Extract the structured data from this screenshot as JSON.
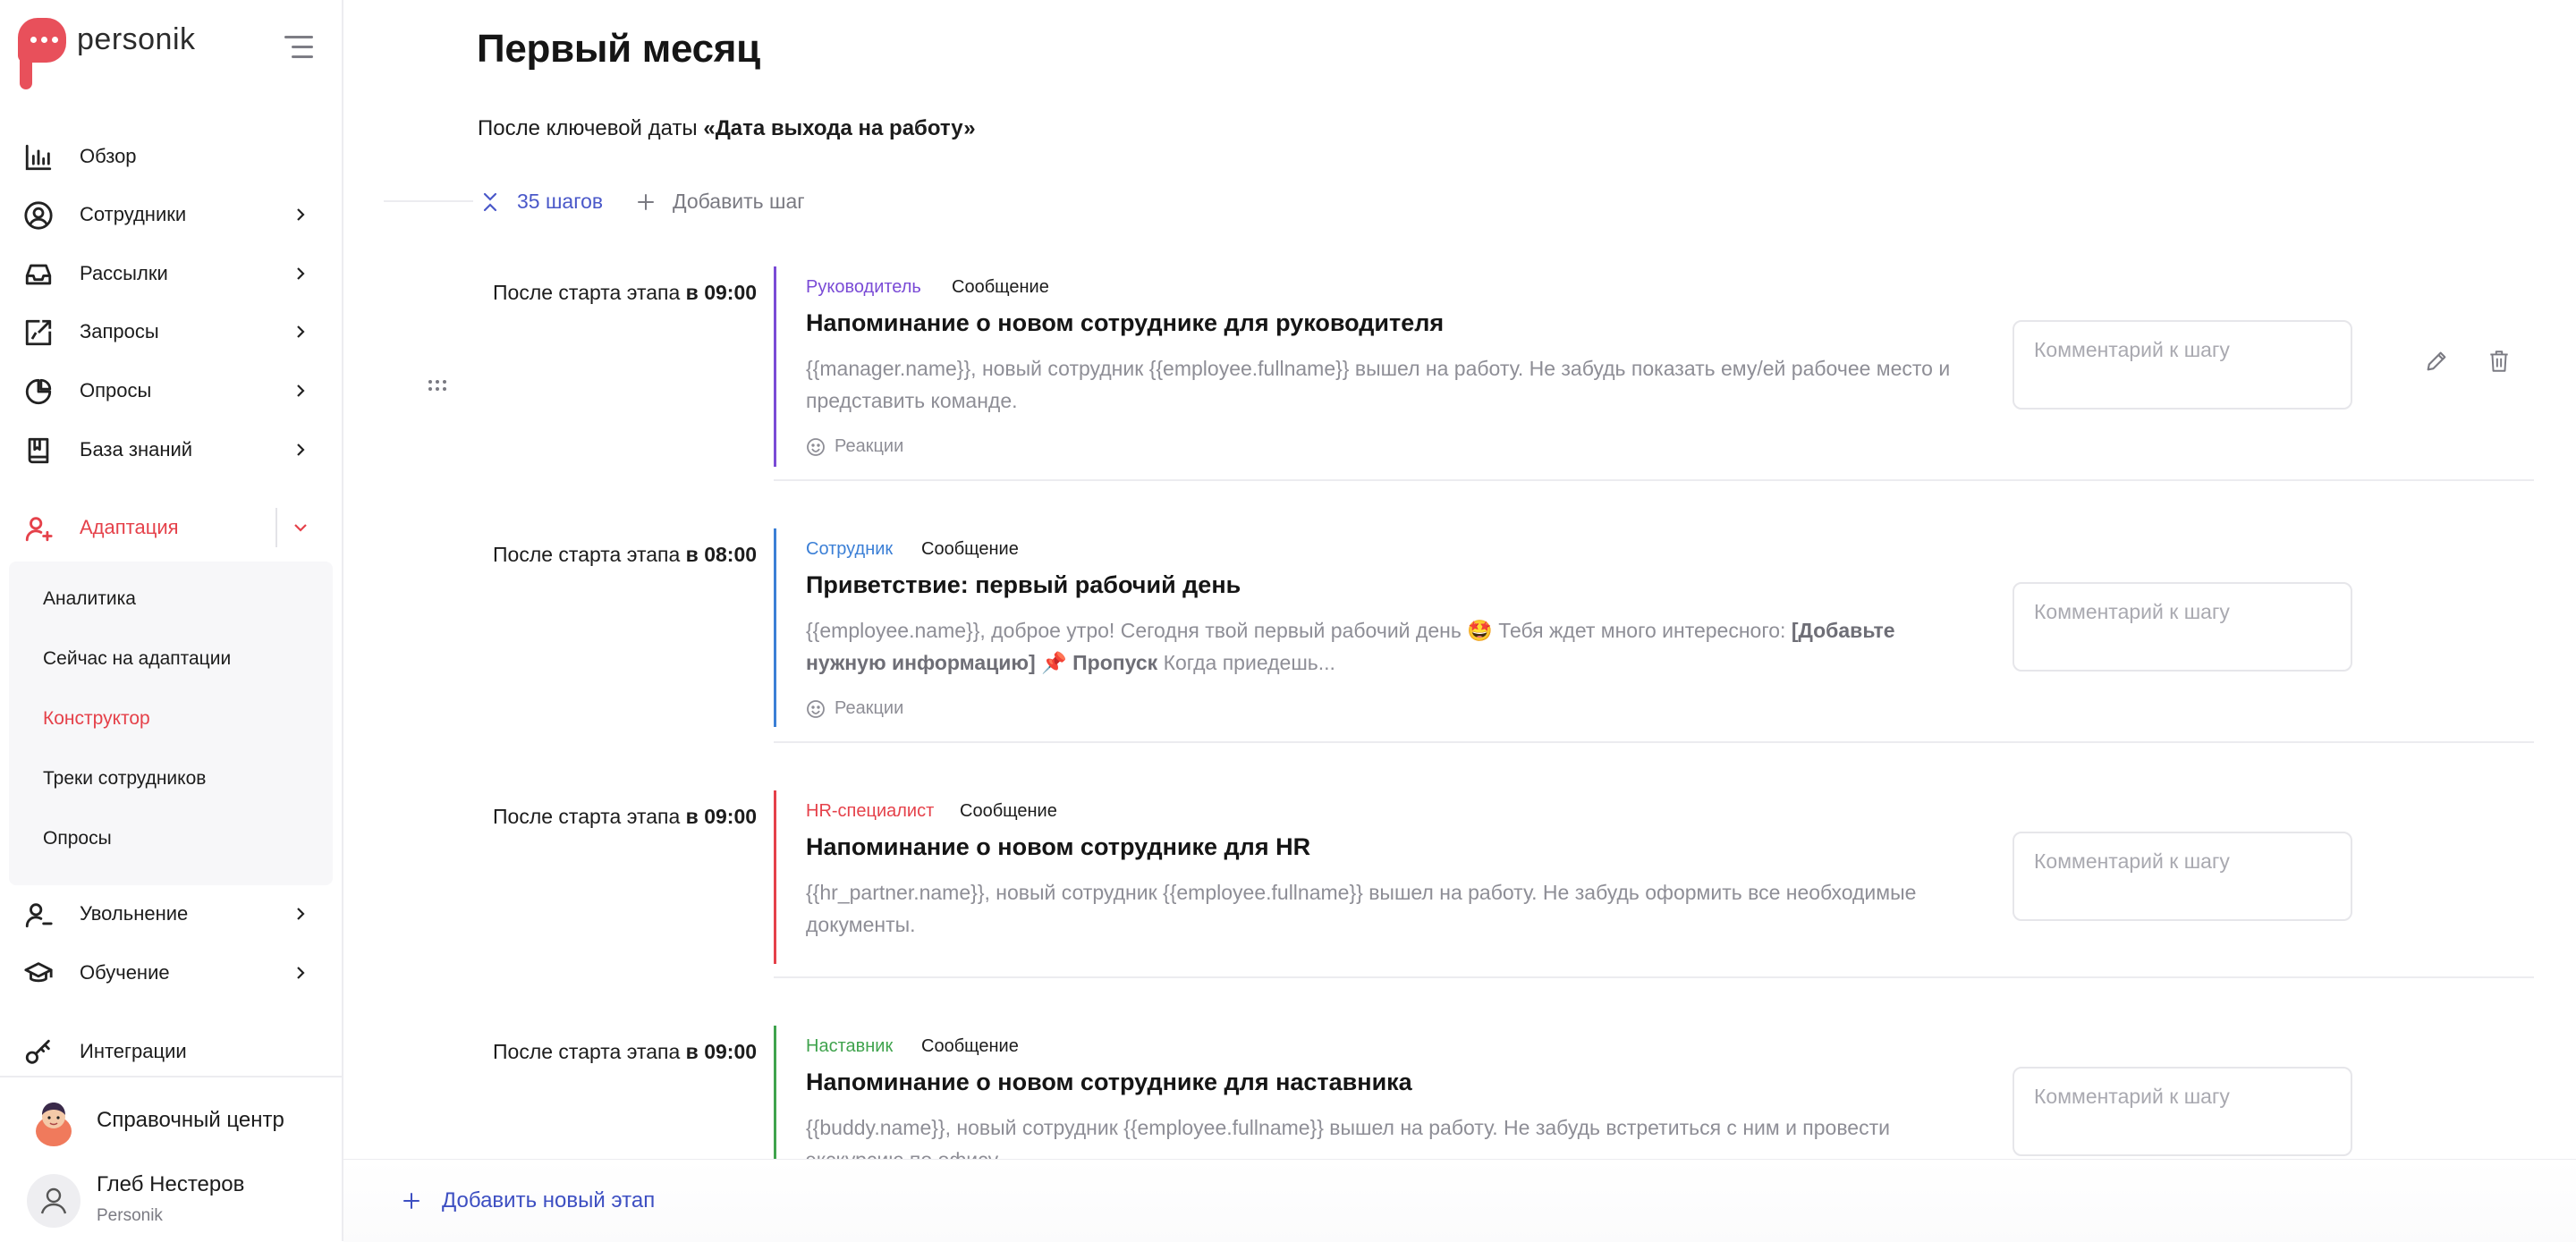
{
  "app": {
    "logo_text": "personik",
    "brand_color": "#e8505b",
    "accent_color": "#4a58c9",
    "active_color": "#e5414a"
  },
  "sidebar": {
    "menu_icon": "hamburger-icon",
    "items": [
      {
        "label": "Обзор",
        "icon": "bar-chart-icon"
      },
      {
        "label": "Сотрудники",
        "icon": "user-circle-icon"
      },
      {
        "label": "Рассылки",
        "icon": "inbox-icon"
      },
      {
        "label": "Запросы",
        "icon": "request-share-icon"
      },
      {
        "label": "Опросы",
        "icon": "pie-chart-icon"
      },
      {
        "label": "База знаний",
        "icon": "book-icon"
      },
      {
        "label": "Адаптация",
        "icon": "user-plus-icon"
      },
      {
        "label": "Увольнение",
        "icon": "user-minus-icon"
      },
      {
        "label": "Обучение",
        "icon": "graduation-cap-icon"
      },
      {
        "label": "Интеграции",
        "icon": "key-icon"
      }
    ],
    "submenu": [
      {
        "label": "Аналитика"
      },
      {
        "label": "Сейчас на адаптации"
      },
      {
        "label": "Конструктор"
      },
      {
        "label": "Треки сотрудников"
      },
      {
        "label": "Опросы"
      }
    ],
    "help_center": "Справочный центр",
    "user": {
      "name": "Глеб Нестеров",
      "org": "Personik"
    }
  },
  "main": {
    "title": "Первый месяц",
    "key_date_prefix": "После ключевой даты",
    "key_date_value": "«Дата выхода на работу»",
    "steps_count": "35 шагов",
    "add_step": "Добавить шаг",
    "add_stage": "Добавить новый этап",
    "steps": [
      {
        "when_prefix": "После старта этапа",
        "when_time": "в 09:00",
        "role": "Руководитель",
        "role_color": "#7a4bd6",
        "type": "Сообщение",
        "title": "Напоминание о новом сотруднике для руководителя",
        "text": "{{manager.name}}, новый сотрудник {{employee.fullname}} вышел на работу. Не забудь показать ему/ей рабочее место и представить команде.",
        "reactions": "Реакции",
        "comment_placeholder": "Комментарий к шагу"
      },
      {
        "when_prefix": "После старта этапа",
        "when_time": "в 08:00",
        "role": "Сотрудник",
        "role_color": "#3b7fd6",
        "type": "Сообщение",
        "title": "Приветствие: первый рабочий день",
        "text_a": "{{employee.name}}, доброе утро! Сегодня твой первый рабочий день 🤩 Тебя ждет много интересного: ",
        "text_b": "[Добавьте нужную информацию]",
        "text_c": " 📌 ",
        "text_d": "Пропуск",
        "text_e": " Когда приедешь...",
        "reactions": "Реакции",
        "comment_placeholder": "Комментарий к шагу"
      },
      {
        "when_prefix": "После старта этапа",
        "when_time": "в 09:00",
        "role": "HR-специалист",
        "role_color": "#e5414a",
        "type": "Сообщение",
        "title": "Напоминание о новом сотруднике для HR",
        "text": "{{hr_partner.name}}, новый сотрудник {{employee.fullname}} вышел на работу. Не забудь оформить все необходимые документы.",
        "comment_placeholder": "Комментарий к шагу"
      },
      {
        "when_prefix": "После старта этапа",
        "when_time": "в 09:00",
        "role": "Наставник",
        "role_color": "#3fa34d",
        "type": "Сообщение",
        "title": "Напоминание о новом сотруднике для наставника",
        "text": "{{buddy.name}}, новый сотрудник {{employee.fullname}} вышел на работу. Не забудь встретиться с ним и провести экскурсию по офису.",
        "comment_placeholder": "Комментарий к шагу"
      }
    ]
  }
}
